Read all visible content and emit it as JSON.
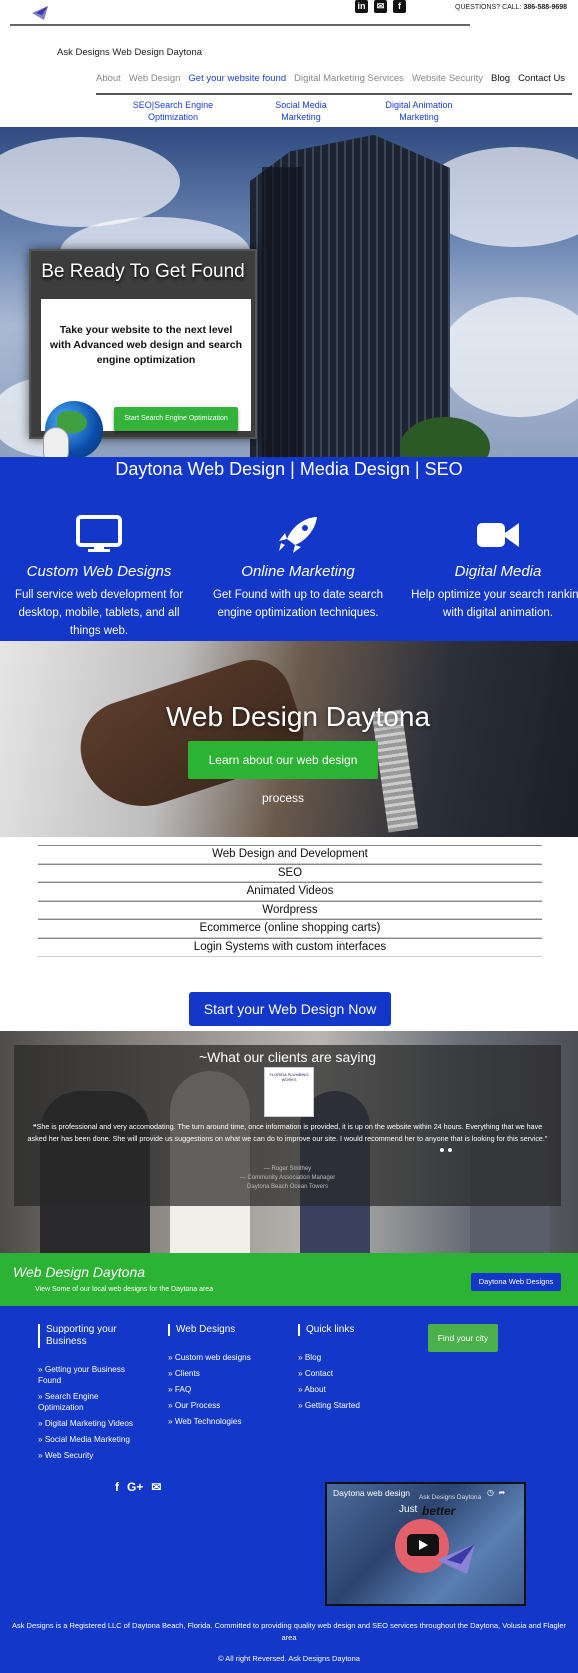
{
  "header": {
    "social": [
      "in",
      "✉",
      "f"
    ],
    "call_prefix": "QUESTIONS? CALL: ",
    "call_number": "386-588-9698",
    "brand": "Ask Designs Web Design Daytona",
    "nav": [
      "About",
      "Web Design",
      "Get your website found",
      "Digital Marketing Services",
      "Website Security",
      "Blog",
      "Contact Us"
    ],
    "subnav": [
      "SEO|Search Engine Optimization",
      "Social Media Marketing",
      "Digital Animation Marketing"
    ]
  },
  "hero": {
    "title": "Be Ready To Get Found",
    "text": "Take your website to the next level with Advanced web design and search engine optimization",
    "button": "Start Search Engine Optimization"
  },
  "services": {
    "heading": "Daytona Web Design | Media Design | SEO",
    "items": [
      {
        "icon": "monitor-icon",
        "title": "Custom Web Designs",
        "text": "Full service web development for desktop, mobile, tablets, and all things web."
      },
      {
        "icon": "rocket-icon",
        "title": "Online Marketing",
        "text": "Get Found with up to date search engine optimization techniques."
      },
      {
        "icon": "video-camera-icon",
        "title": "Digital Media",
        "text": "Help optimize your search ranking with digital animation."
      }
    ]
  },
  "process": {
    "title": "Web Design Daytona",
    "button": "Learn about our web design process"
  },
  "offerings": [
    "Web Design and Development",
    "SEO",
    "Animated Videos",
    "Wordpress",
    "Ecommerce (online shopping carts)",
    "Login Systems with custom interfaces"
  ],
  "cta": "Start your Web Design Now",
  "testimonials": {
    "heading": "~What our clients are saying",
    "logo_text": "FLORIDA PLUMBING WORKS",
    "quote": "❝She is professional and very accomodating. The turn around time, once information is provided, it is up on the website within 24 hours. Everything that we have asked her has been done. She will provide us suggestions on what we can do to improve our site. I would recommend her to anyone that is looking for this service.\"",
    "author": "— Roger Smithey",
    "author_role": "— Community Association Manager",
    "author_org": "Daytona Beach Ocean Towers"
  },
  "local": {
    "title": "Web Design Daytona",
    "subtitle": "View Some of our local web designs for the Daytona area",
    "button": "Daytona Web Designs"
  },
  "footer": {
    "col1": {
      "title": "Supporting your Business",
      "items": [
        "» Getting your Business Found",
        "» Search Engine Optimization",
        "» Digital Marketing Videos",
        "» Social Media Marketing",
        "» Web Security"
      ]
    },
    "col2": {
      "title": "Web Designs",
      "items": [
        "» Custom web designs",
        "» Clients",
        "» FAQ",
        "» Our Process",
        "» Web Technologies"
      ]
    },
    "col3": {
      "title": "Quick links",
      "items": [
        "» Blog",
        "» Contact",
        "» About",
        "» Getting Started"
      ]
    },
    "find_city": "Find your city",
    "social": [
      "f",
      "G+",
      "✉"
    ],
    "video": {
      "title": "Daytona web design",
      "subtitle": "Ask Designs Daytona",
      "just": "Just",
      "better": "better"
    },
    "note": "Ask Designs is a Registered LLC of Daytona Beach, Florida. Committed to providing quality web design and SEO services throughout the Daytona, Volusia and Flagler area",
    "copyright": "© All right Reversed.  Ask Designs Daytona"
  },
  "colors": {
    "brand_blue": "#1337c9",
    "green": "#2db334"
  }
}
